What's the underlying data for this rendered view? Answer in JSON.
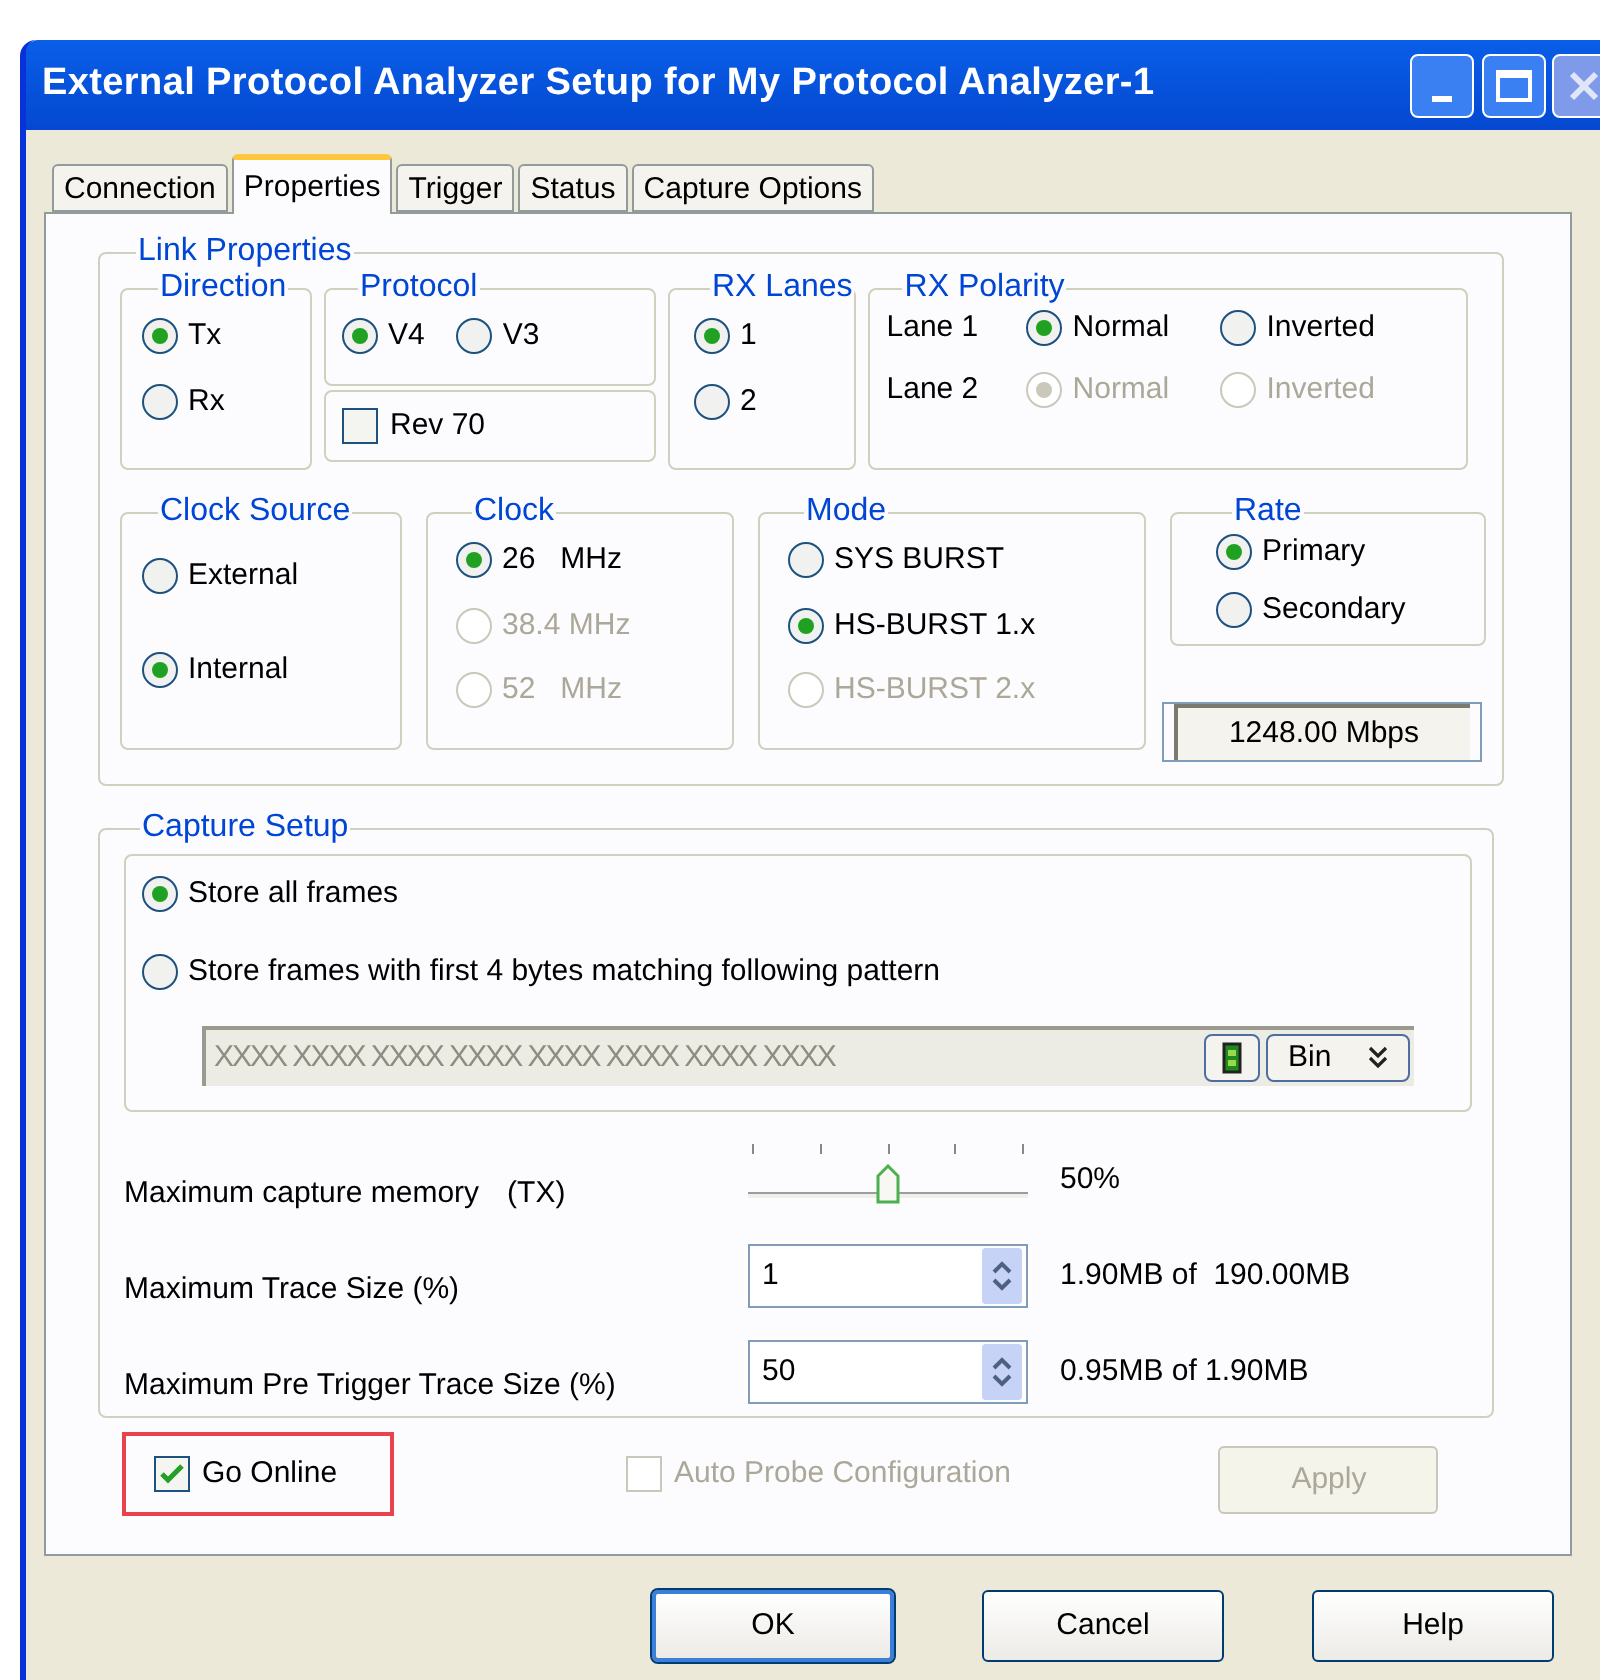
{
  "window": {
    "title": "External Protocol Analyzer Setup for My Protocol Analyzer-1"
  },
  "tabs": [
    {
      "label": "Connection",
      "selected": false
    },
    {
      "label": "Properties",
      "selected": true
    },
    {
      "label": "Trigger",
      "selected": false
    },
    {
      "label": "Status",
      "selected": false
    },
    {
      "label": "Capture Options",
      "selected": false
    }
  ],
  "link_properties": {
    "title": "Link Properties",
    "direction": {
      "title": "Direction",
      "options": [
        {
          "label": "Tx",
          "selected": true,
          "disabled": false
        },
        {
          "label": "Rx",
          "selected": false,
          "disabled": false
        }
      ]
    },
    "protocol": {
      "title": "Protocol",
      "options": [
        {
          "label": "V4",
          "selected": true,
          "disabled": false
        },
        {
          "label": "V3",
          "selected": false,
          "disabled": false
        }
      ],
      "revision": {
        "label": "Rev 70",
        "checked": false
      }
    },
    "rx_lanes": {
      "title": "RX Lanes",
      "options": [
        {
          "label": "1",
          "selected": true,
          "disabled": false
        },
        {
          "label": "2",
          "selected": false,
          "disabled": false
        }
      ]
    },
    "rx_polarity": {
      "title": "RX Polarity",
      "lanes": [
        {
          "label": "Lane 1",
          "options": [
            {
              "label": "Normal",
              "selected": true,
              "disabled": false
            },
            {
              "label": "Inverted",
              "selected": false,
              "disabled": false
            }
          ]
        },
        {
          "label": "Lane 2",
          "options": [
            {
              "label": "Normal",
              "selected": true,
              "disabled": true
            },
            {
              "label": "Inverted",
              "selected": false,
              "disabled": true
            }
          ]
        }
      ]
    },
    "clock_source": {
      "title": "Clock Source",
      "options": [
        {
          "label": "External",
          "selected": false,
          "disabled": false
        },
        {
          "label": "Internal",
          "selected": true,
          "disabled": false
        }
      ]
    },
    "clock": {
      "title": "Clock",
      "options": [
        {
          "label": "26   MHz",
          "selected": true,
          "disabled": false
        },
        {
          "label": "38.4 MHz",
          "selected": false,
          "disabled": true
        },
        {
          "label": "52   MHz",
          "selected": false,
          "disabled": true
        }
      ]
    },
    "mode": {
      "title": "Mode",
      "options": [
        {
          "label": "SYS BURST",
          "selected": false,
          "disabled": false
        },
        {
          "label": "HS-BURST 1.x",
          "selected": true,
          "disabled": false
        },
        {
          "label": "HS-BURST 2.x",
          "selected": false,
          "disabled": true
        }
      ]
    },
    "rate": {
      "title": "Rate",
      "options": [
        {
          "label": "Primary",
          "selected": true,
          "disabled": false
        },
        {
          "label": "Secondary",
          "selected": false,
          "disabled": false
        }
      ],
      "value": "1248.00 Mbps"
    }
  },
  "capture_setup": {
    "title": "Capture Setup",
    "options": [
      {
        "label": "Store all frames",
        "selected": true,
        "disabled": false
      },
      {
        "label": "Store frames with first 4 bytes matching following pattern",
        "selected": false,
        "disabled": false
      }
    ],
    "pattern": {
      "value": "XXXX XXXX XXXX XXXX XXXX XXXX XXXX XXXX",
      "disabled": true,
      "format": "Bin"
    },
    "settings": [
      {
        "kind": "slider",
        "label": "Maximum capture memory",
        "suffix": "(TX)",
        "level": 0.5,
        "reading": "50%"
      },
      {
        "kind": "spin",
        "label": "Maximum Trace Size (%)",
        "value": "1",
        "reading": "1.90MB of  190.00MB"
      },
      {
        "kind": "spin",
        "label": "Maximum Pre Trigger Trace Size (%)",
        "value": "50",
        "reading": "0.95MB of 1.90MB"
      }
    ]
  },
  "go_online": {
    "label": "Go Online",
    "checked": true,
    "highlighted": true
  },
  "auto_probe": {
    "label": "Auto Probe Configuration",
    "checked": false,
    "disabled": true
  },
  "apply_button": {
    "label": "Apply",
    "disabled": true
  },
  "buttons": [
    {
      "label": "OK",
      "default": true
    },
    {
      "label": "Cancel",
      "default": false
    },
    {
      "label": "Help",
      "default": false
    }
  ]
}
